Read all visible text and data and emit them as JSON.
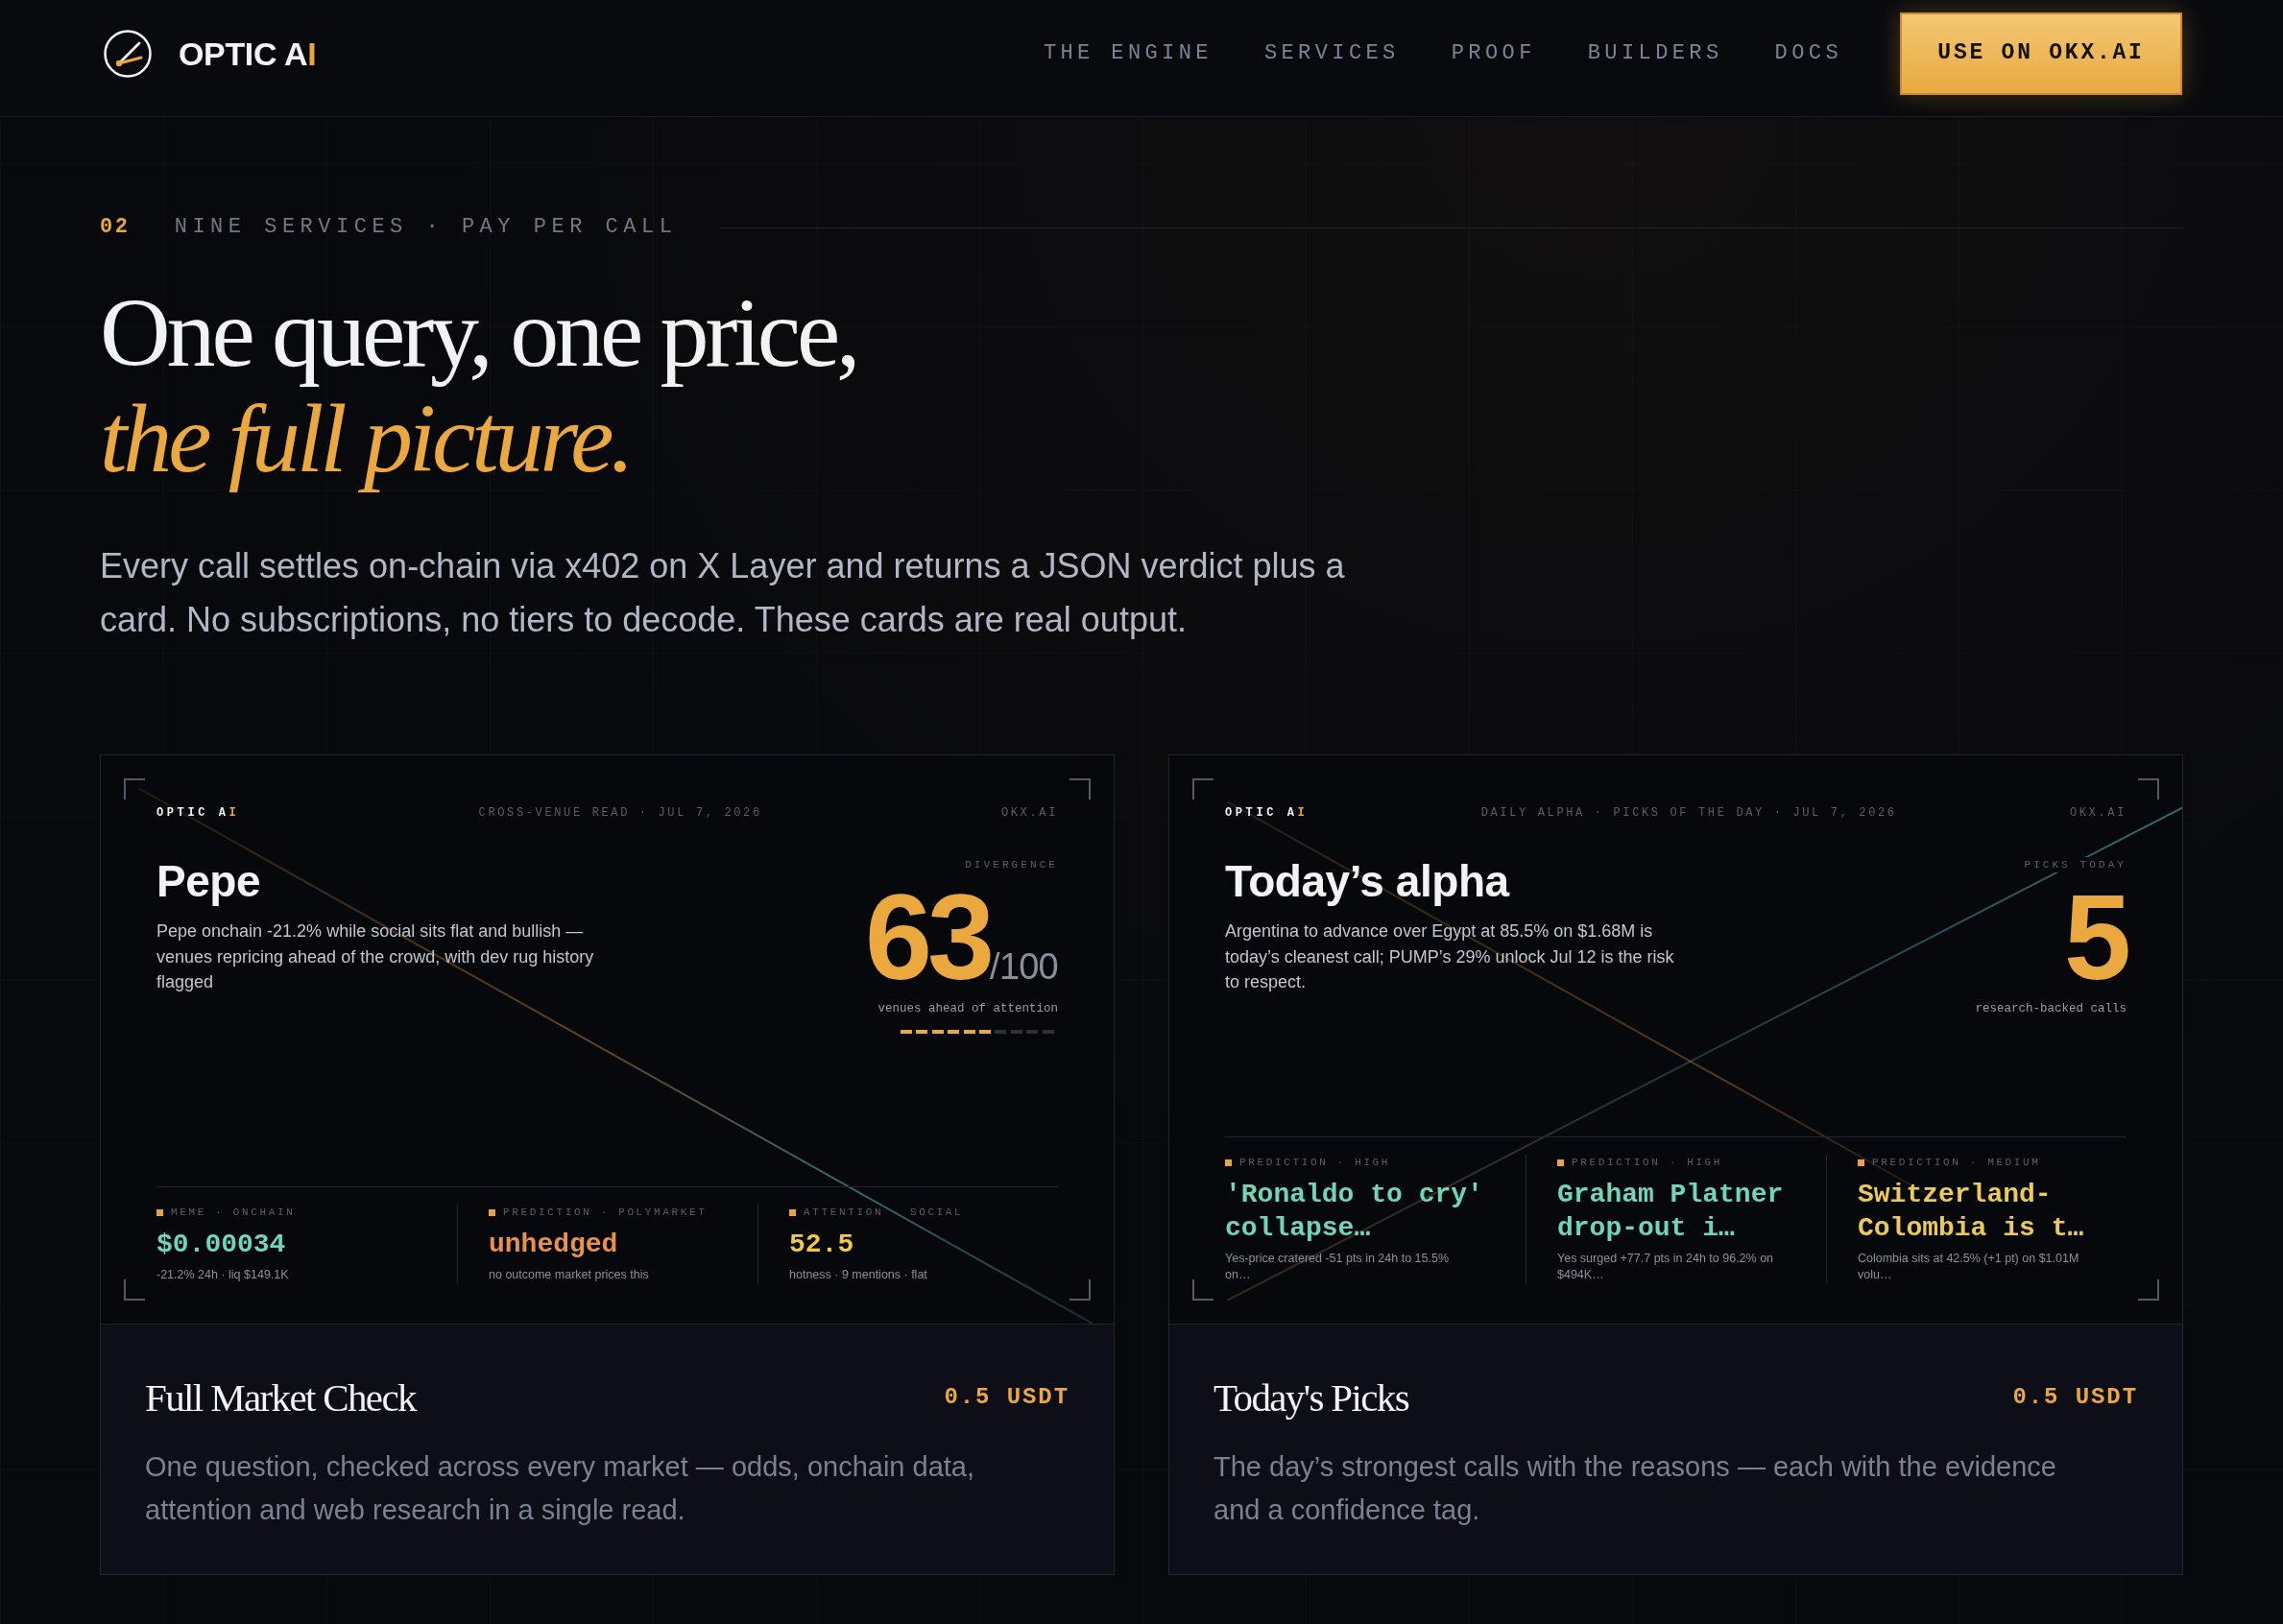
{
  "header": {
    "brand": {
      "text": "OPTIC A",
      "accent": "I"
    },
    "nav": [
      "THE ENGINE",
      "SERVICES",
      "PROOF",
      "BUILDERS",
      "DOCS"
    ],
    "cta": "USE ON OKX.AI"
  },
  "section": {
    "number": "02",
    "eyebrow": "NINE SERVICES · PAY PER CALL",
    "heading": "One query, one price,",
    "heading_accent": "the full picture.",
    "intro": "Every call settles on-chain via x402 on X Layer and returns a JSON verdict plus a card. No subscriptions, no tiers to decode. These cards are real output."
  },
  "services": [
    {
      "kind": "score",
      "preview": {
        "brand": {
          "text": "OPTIC A",
          "accent": "I"
        },
        "tagline": "CROSS-VENUE READ · JUL 7, 2026",
        "site": "OKX.AI",
        "title": "Pepe",
        "summary": "Pepe onchain -21.2% while social sits flat and bullish — venues repricing ahead of the crowd, with dev rug history flagged",
        "stat_label": "DIVERGENCE",
        "stat": "63",
        "stat_suffix": "/100",
        "stat_caption": "venues ahead of attention",
        "level": 0.6,
        "metrics": [
          {
            "label": "MEME · ONCHAIN",
            "value": "$0.00034",
            "detail": "-21.2% 24h · liq $149.1K",
            "color": "#6fd6b6"
          },
          {
            "label": "PREDICTION · POLYMARKET",
            "value": "unhedged",
            "detail": "no outcome market prices this",
            "color": "#e8924c"
          },
          {
            "label": "ATTENTION · SOCIAL",
            "value": "52.5",
            "detail": "hotness · 9 mentions · flat",
            "color": "#f2c84b"
          }
        ]
      },
      "name": "Full Market Check",
      "price": "0.5 USDT",
      "description": "One question, checked across every market — odds, onchain data, attention and web research in a single read."
    },
    {
      "kind": "count",
      "preview": {
        "brand": {
          "text": "OPTIC A",
          "accent": "I"
        },
        "tagline": "DAILY ALPHA · PICKS OF THE DAY · JUL 7, 2026",
        "site": "OKX.AI",
        "title": "Today’s alpha",
        "summary": "Argentina to advance over Egypt at 85.5% on $1.68M is today’s cleanest call; PUMP’s 29% unlock Jul 12 is the risk to respect.",
        "stat_label": "PICKS TODAY",
        "stat": "5",
        "stat_caption": "research-backed calls",
        "metrics": [
          {
            "label": "PREDICTION · HIGH",
            "value": "'Ronaldo to cry' collapse…",
            "detail": "Yes-price cratered -51 pts in 24h to 15.5% on…",
            "color": "#6fd6b6"
          },
          {
            "label": "PREDICTION · HIGH",
            "value": "Graham Platner drop-out i…",
            "detail": "Yes surged +77.7 pts in 24h to 96.2% on $494K…",
            "color": "#6fd6b6"
          },
          {
            "label": "PREDICTION · MEDIUM",
            "value": "Switzerland-Colombia is t…",
            "detail": "Colombia sits at 42.5% (+1 pt) on $1.01M volu…",
            "color": "#ecca5a"
          }
        ]
      },
      "name": "Today's Picks",
      "price": "0.5 USDT",
      "description": "The day’s strongest calls with the reasons — each with the evidence and a confidence tag."
    }
  ]
}
